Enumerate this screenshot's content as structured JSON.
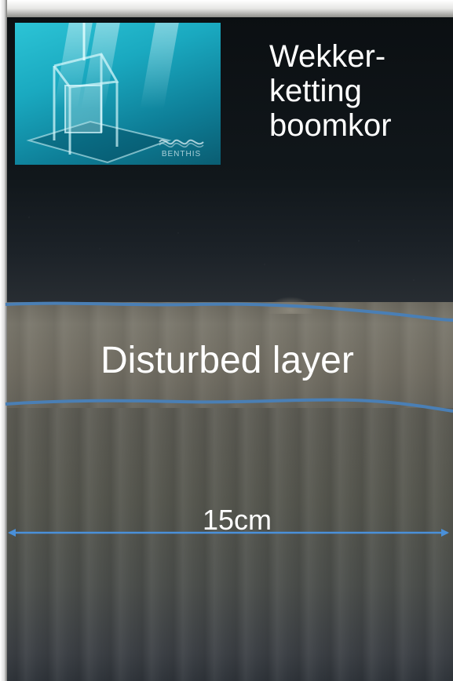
{
  "photo": {
    "inset": {
      "logo_text": "BENTHIS"
    },
    "title_lines": [
      "Wekker-",
      "ketting",
      "boomkor"
    ],
    "layer_label": "Disturbed layer",
    "measurement": {
      "label": "15cm"
    }
  },
  "colors": {
    "boundary_line": "#4a7fb5",
    "measure_arrow": "#4a90d9",
    "text": "#ffffff"
  },
  "icons": {
    "measure_arrows": "double-headed-arrow",
    "logo": "benthis-logo-icon"
  }
}
